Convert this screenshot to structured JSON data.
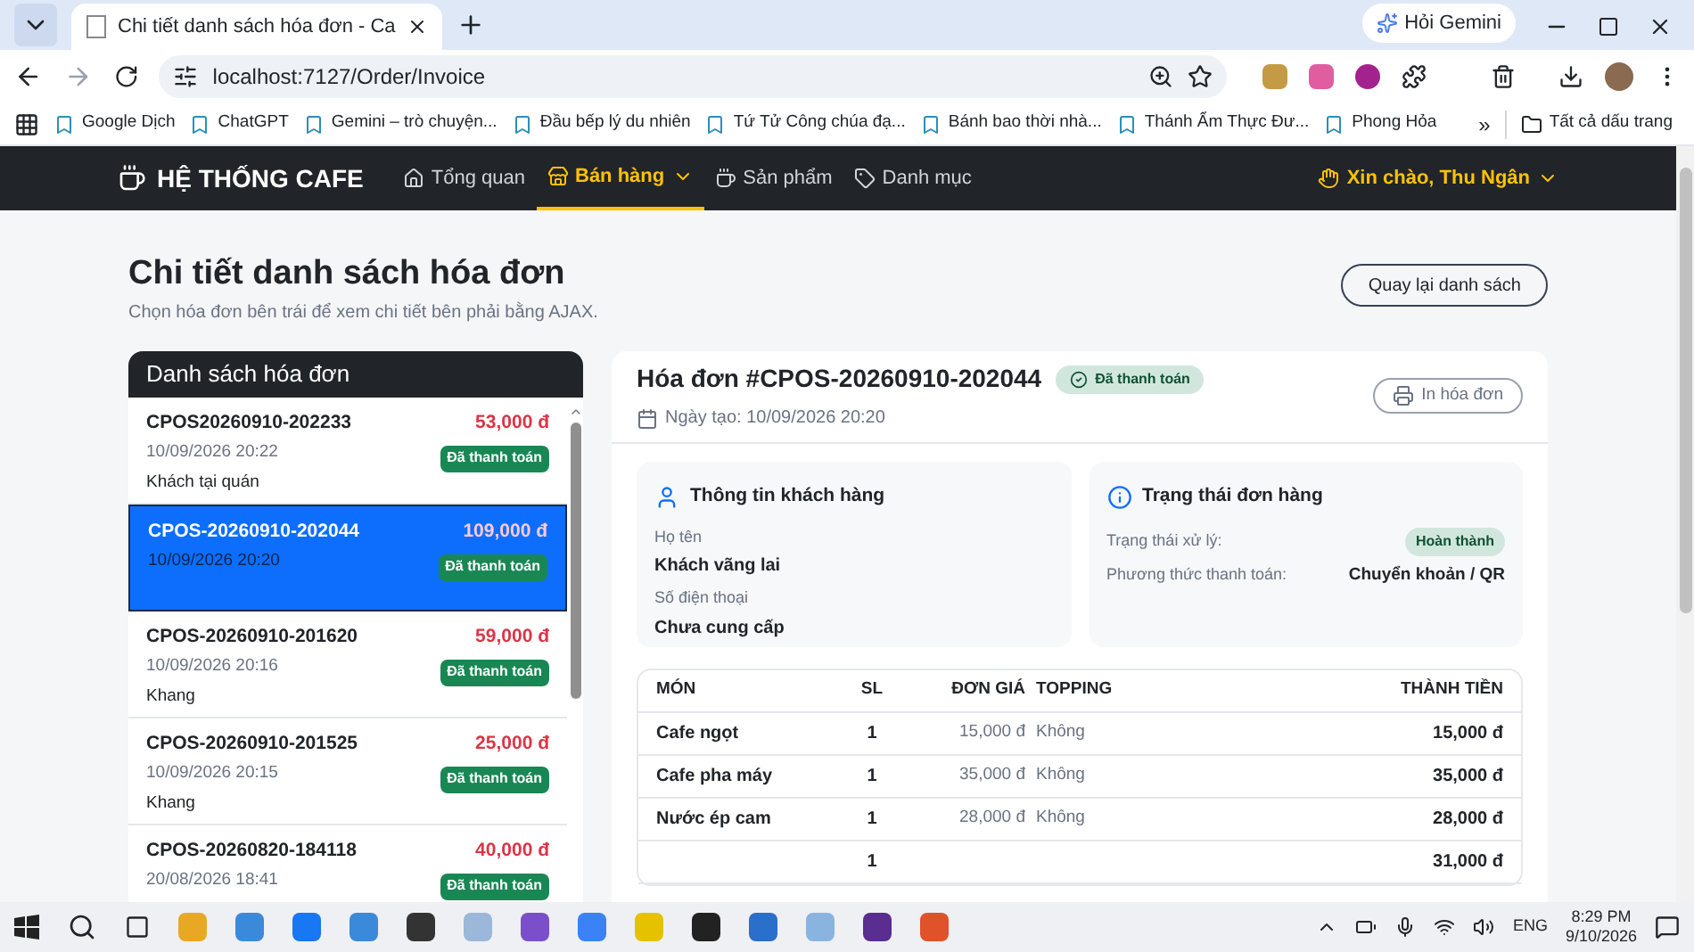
{
  "browser": {
    "tabs": [
      {
        "title": "Chi tiết danh sách hóa đơn - Ca",
        "selected": true
      }
    ],
    "gemini_button": "Hỏi Gemini",
    "url": "localhost:7127/Order/Invoice",
    "bookmarks": [
      "Google Dịch",
      "ChatGPT",
      "Gemini – trò chuyện...",
      "Đầu bếp lý du nhiên",
      "Tứ Tử Công chúa đạ...",
      "Bánh bao thời nhà...",
      "Thánh Ẩm Thực Đư...",
      "Phong Hỏa"
    ],
    "more_bookmarks": "»",
    "all_bookmarks": "Tất cả dấu trang"
  },
  "navbar": {
    "brand": "HỆ THỐNG CAFE",
    "items": [
      {
        "label": "Tổng quan",
        "selected": false,
        "dropdown": false
      },
      {
        "label": "Bán hàng",
        "selected": true,
        "dropdown": true
      },
      {
        "label": "Sản phẩm",
        "selected": false,
        "dropdown": false
      },
      {
        "label": "Danh mục",
        "selected": false,
        "dropdown": false
      }
    ],
    "user": "Xin chào, Thu Ngân"
  },
  "page": {
    "title": "Chi tiết danh sách hóa đơn",
    "subtitle": "Chọn hóa đơn bên trái để xem chi tiết bên phải bằng AJAX.",
    "back_button": "Quay lại danh sách"
  },
  "invoice_list": {
    "title": "Danh sách hóa đơn",
    "items": [
      {
        "code": "CPOS20260910-202233",
        "amount": "53,000 đ",
        "date": "10/09/2026 20:22",
        "customer": "Khách tại quán",
        "status": "Đã thanh toán",
        "selected": false
      },
      {
        "code": "CPOS-20260910-202044",
        "amount": "109,000 đ",
        "date": "10/09/2026 20:20",
        "status": "Đã thanh toán",
        "selected": true
      },
      {
        "code": "CPOS-20260910-201620",
        "amount": "59,000 đ",
        "date": "10/09/2026 20:16",
        "customer": "Khang",
        "status": "Đã thanh toán",
        "selected": false
      },
      {
        "code": "CPOS-20260910-201525",
        "amount": "25,000 đ",
        "date": "10/09/2026 20:15",
        "customer": "Khang",
        "status": "Đã thanh toán",
        "selected": false
      },
      {
        "code": "CPOS-20260820-184118",
        "amount": "40,000 đ",
        "date": "20/08/2026 18:41",
        "status": "Đã thanh toán",
        "selected": false
      }
    ]
  },
  "invoice": {
    "title": "Hóa đơn #CPOS-20260910-202044",
    "status": "Đã thanh toán",
    "created": "Ngày tạo: 10/09/2026 20:20",
    "print_button": "In hóa đơn",
    "customer": {
      "title": "Thông tin khách hàng",
      "fields": [
        {
          "label": "Họ tên",
          "value": "Khách vãng lai"
        },
        {
          "label": "Số điện thoại",
          "value": "Chưa cung cấp"
        }
      ]
    },
    "order_status": {
      "title": "Trạng thái đơn hàng",
      "rows": [
        {
          "label": "Trạng thái xử lý:",
          "value": "Hoàn thành",
          "kind": "badge"
        },
        {
          "label": "Phương thức thanh toán:",
          "value": "Chuyển khoản / QR",
          "kind": "text"
        }
      ]
    },
    "table": {
      "columns": [
        "MÓN",
        "SL",
        "ĐƠN GIÁ",
        "TOPPING",
        "THÀNH TIỀN"
      ],
      "rows": [
        {
          "name": "Cafe ngọt",
          "qty": "1",
          "unit_price": "15,000 đ",
          "topping": "Không",
          "total": "15,000 đ"
        },
        {
          "name": "Cafe pha máy",
          "qty": "1",
          "unit_price": "35,000 đ",
          "topping": "Không",
          "total": "35,000 đ"
        },
        {
          "name": "Nước ép cam",
          "qty": "1",
          "unit_price": "28,000 đ",
          "topping": "Không",
          "total": "28,000 đ"
        },
        {
          "qty": "1",
          "total": "31,000 đ"
        }
      ]
    }
  },
  "taskbar": {
    "language": "ENG",
    "time": "8:29 PM",
    "date": "9/10/2026"
  }
}
